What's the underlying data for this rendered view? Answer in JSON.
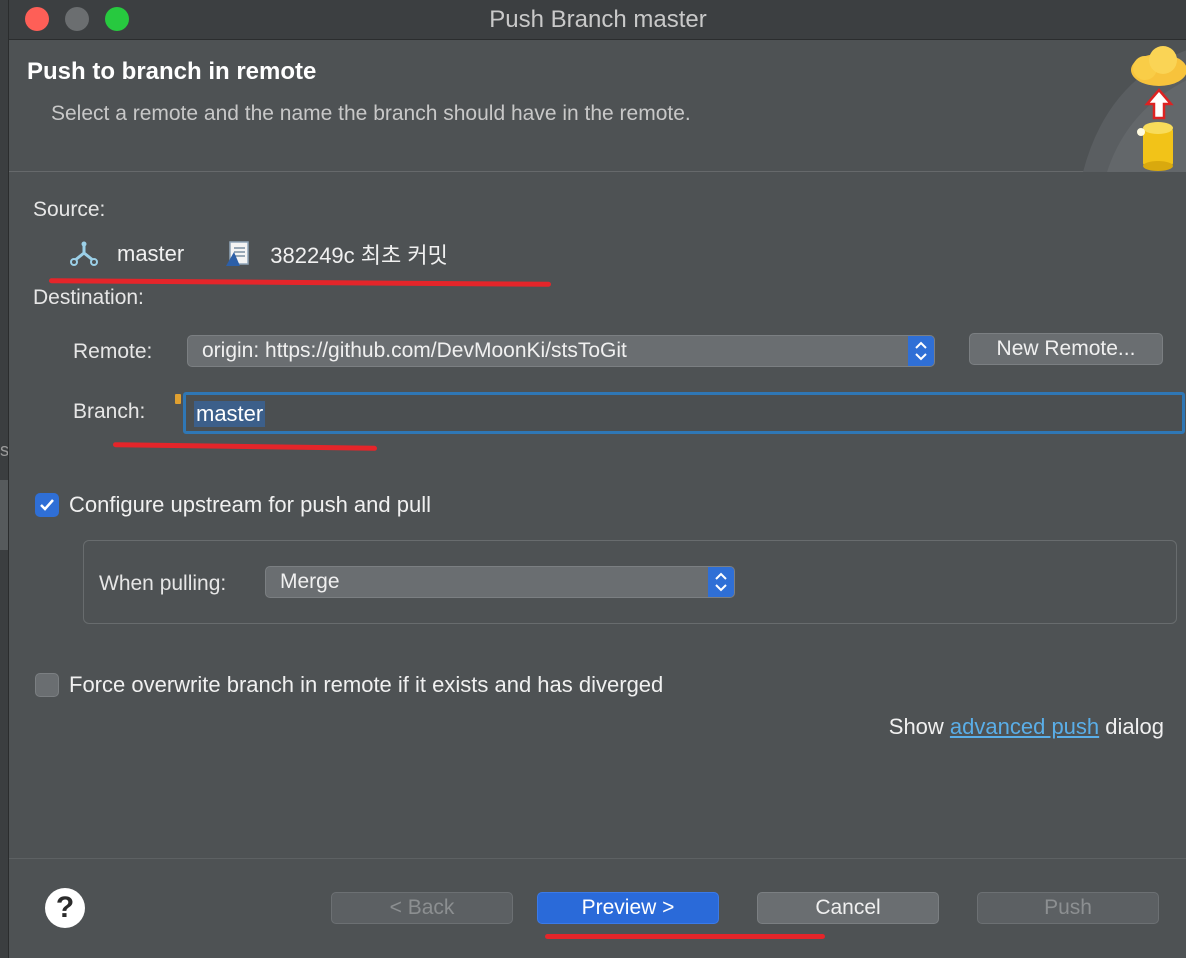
{
  "window": {
    "title": "Push Branch master"
  },
  "header": {
    "title": "Push to branch in remote",
    "subtitle": "Select a remote and the name the branch should have in the remote."
  },
  "source": {
    "label": "Source:",
    "branch": "master",
    "commit": "382249c 최초 커밋"
  },
  "destination": {
    "label": "Destination:",
    "remote_label": "Remote:",
    "remote_value": "origin: https://github.com/DevMoonKi/stsToGit",
    "new_remote_button": "New Remote...",
    "branch_label": "Branch:",
    "branch_value": "master"
  },
  "options": {
    "configure_upstream": {
      "label": "Configure upstream for push and pull",
      "checked": true
    },
    "when_pulling_label": "When pulling:",
    "when_pulling_value": "Merge",
    "force_overwrite": {
      "label": "Force overwrite branch in remote if it exists and has diverged",
      "checked": false
    }
  },
  "advanced": {
    "prefix": "Show ",
    "link": "advanced push",
    "suffix": " dialog"
  },
  "footer": {
    "help": "?",
    "back": "< Back",
    "preview": "Preview >",
    "cancel": "Cancel",
    "push": "Push"
  },
  "colors": {
    "accent": "#2f6fd6",
    "annotation": "#e5252a",
    "link": "#5aaee8"
  },
  "icons": [
    "branch-icon",
    "commit-icon",
    "cloud-push-icon",
    "help-icon"
  ]
}
